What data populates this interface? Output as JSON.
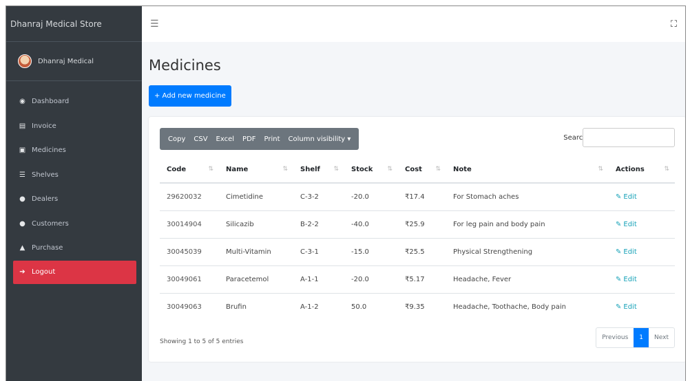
{
  "brand": "Dhanraj Medical Store",
  "user": "Dhanraj Medical",
  "nav": [
    {
      "label": "Dashboard",
      "icon": "dashboard-icon"
    },
    {
      "label": "Invoice",
      "icon": "invoice-icon"
    },
    {
      "label": "Medicines",
      "icon": "medicines-icon"
    },
    {
      "label": "Shelves",
      "icon": "shelves-icon"
    },
    {
      "label": "Dealers",
      "icon": "dealers-icon"
    },
    {
      "label": "Customers",
      "icon": "customers-icon"
    },
    {
      "label": "Purchase",
      "icon": "purchase-icon"
    },
    {
      "label": "Logout",
      "icon": "logout-icon"
    }
  ],
  "page_title": "Medicines",
  "add_button": "+ Add new medicine",
  "table_buttons": {
    "copy": "Copy",
    "csv": "CSV",
    "excel": "Excel",
    "pdf": "PDF",
    "print": "Print",
    "colvis": "Column visibility ▾"
  },
  "search_label": "Search:",
  "columns": [
    "Code",
    "Name",
    "Shelf",
    "Stock",
    "Cost",
    "Note",
    "Actions"
  ],
  "rows": [
    {
      "code": "29620032",
      "name": "Cimetidine",
      "shelf": "C-3-2",
      "stock": "-20.0",
      "cost": "₹17.4",
      "note": "For Stomach aches",
      "action": "Edit"
    },
    {
      "code": "30014904",
      "name": "Silicazib",
      "shelf": "B-2-2",
      "stock": "-40.0",
      "cost": "₹25.9",
      "note": "For leg pain and body pain",
      "action": "Edit"
    },
    {
      "code": "30045039",
      "name": "Multi-Vitamin",
      "shelf": "C-3-1",
      "stock": "-15.0",
      "cost": "₹25.5",
      "note": "Physical Strengthening",
      "action": "Edit"
    },
    {
      "code": "30049061",
      "name": "Paracetemol",
      "shelf": "A-1-1",
      "stock": "-20.0",
      "cost": "₹5.17",
      "note": "Headache, Fever",
      "action": "Edit"
    },
    {
      "code": "30049063",
      "name": "Brufin",
      "shelf": "A-1-2",
      "stock": "50.0",
      "cost": "₹9.35",
      "note": "Headache, Toothache, Body pain",
      "action": "Edit"
    }
  ],
  "info": "Showing 1 to 5 of 5 entries",
  "pager": {
    "prev": "Previous",
    "page": "1",
    "next": "Next"
  },
  "colors": {
    "sidebar": "#343a40",
    "primary": "#007bff",
    "danger": "#dc3545",
    "info": "#17a2b8",
    "button_group": "#6c757d"
  }
}
